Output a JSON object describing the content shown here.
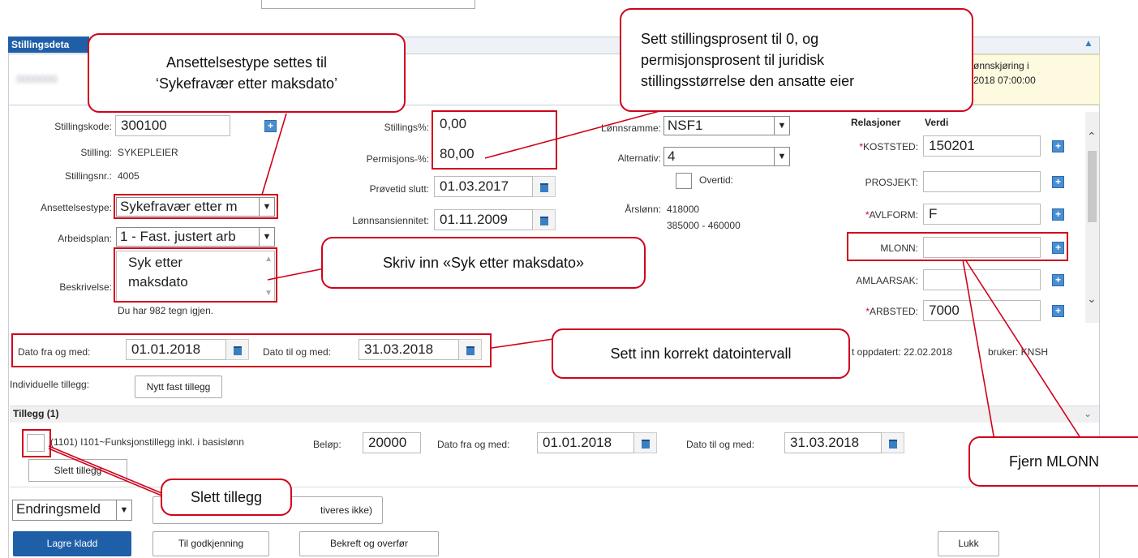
{
  "panel": {
    "title": "Stillingsdeta",
    "name_blurred": "0000000",
    "notice_line1": "ønnskjøring i",
    "notice_line2": "2018 07:00:00"
  },
  "left": {
    "stillingskode_label": "Stillingskode:",
    "stillingskode_value": "300100",
    "stilling_label": "Stilling:",
    "stilling_value": "SYKEPLEIER",
    "stillingsnr_label": "Stillingsnr.:",
    "stillingsnr_value": "4005",
    "ansettelsestype_label": "Ansettelsestype:",
    "ansettelsestype_value": "Sykefravær etter m",
    "arbeidsplan_label": "Arbeidsplan:",
    "arbeidsplan_value": "1 - Fast. justert arb",
    "beskrivelse_label": "Beskrivelse:",
    "beskrivelse_line1": "Syk etter",
    "beskrivelse_line2": "maksdato",
    "chars_left": "Du har 982 tegn igjen."
  },
  "middle": {
    "stillingspct_label": "Stillings%:",
    "stillingspct_value": "0,00",
    "permisjonspct_label": "Permisjons-%:",
    "permisjonspct_value": "80,00",
    "provetid_label": "Prøvetid slutt:",
    "provetid_value": "01.03.2017",
    "lonnsansiennitet_label": "Lønnsansiennitet:",
    "lonnsansiennitet_value": "01.11.2009"
  },
  "lonn": {
    "lonnsramme_label": "Lønnsramme:",
    "lonnsramme_value": "NSF1",
    "alternativ_label": "Alternativ:",
    "alternativ_value": "4",
    "overtid_label": "Overtid:",
    "arslonn_label": "Årslønn:",
    "arslonn_value": "418000",
    "arslonn_range": "385000 - 460000"
  },
  "relasjoner": {
    "header_rel": "Relasjoner",
    "header_verdi": "Verdi",
    "rows": [
      {
        "label": "KOSTSTED:",
        "required": true,
        "value": "150201"
      },
      {
        "label": "PROSJEKT:",
        "required": false,
        "value": ""
      },
      {
        "label": "AVLFORM:",
        "required": true,
        "value": "F"
      },
      {
        "label": "MLONN:",
        "required": false,
        "value": ""
      },
      {
        "label": "AMLAARSAK:",
        "required": false,
        "value": ""
      },
      {
        "label": "ARBSTED:",
        "required": true,
        "value": "7000"
      }
    ],
    "req_mark": "*"
  },
  "dates": {
    "fra_label": "Dato fra og med:",
    "fra_value": "01.01.2018",
    "til_label": "Dato til og med:",
    "til_value": "31.03.2018",
    "updated_text": "t oppdatert: 22.02.2018",
    "user_text": "bruker: KNSH"
  },
  "tillegg": {
    "individuelle_label": "Individuelle tillegg:",
    "nytt_button": "Nytt fast tillegg",
    "section_title": "Tillegg (1)",
    "row_label": "(1101) I101~Funksjonstillegg inkl. i basislønn",
    "belop_label": "Beløp:",
    "belop_value": "20000",
    "fra_label": "Dato fra og med:",
    "fra_value": "01.01.2018",
    "til_label": "Dato til og med:",
    "til_value": "31.03.2018",
    "slett_button": "Slett tillegg"
  },
  "bottom": {
    "endring_value": "Endringsmeld",
    "aktiveres_text": "tiveres ikke)",
    "lagre": "Lagre kladd",
    "godkjenning": "Til godkjenning",
    "bekreft": "Bekreft og overfør",
    "lukk": "Lukk"
  },
  "callouts": {
    "ansettelse": "Ansettelsestype settes til\n‘Sykefravær etter maksdato’",
    "stillingsprosent": "Sett stillingsprosent til 0, og\npermisjonsprosent til juridisk\nstillingsstørrelse den ansatte eier",
    "skriv": "Skriv inn «Syk etter maksdato»",
    "dato": "Sett inn korrekt datointervall",
    "slett": "Slett tillegg",
    "mlonn": "Fjern MLONN"
  }
}
